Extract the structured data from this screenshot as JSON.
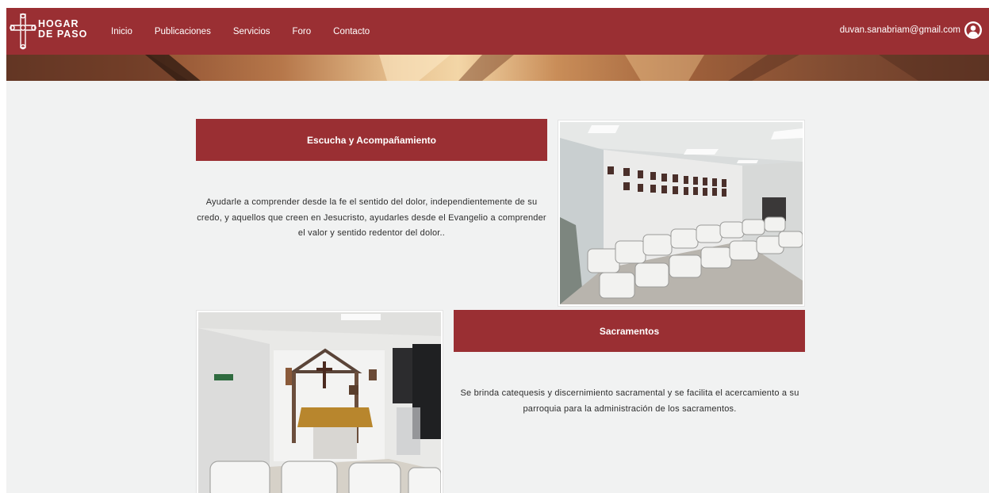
{
  "brand": {
    "line1": "HOGAR",
    "line2": "DE PASO",
    "icon": "cross-logo-icon"
  },
  "nav": {
    "items": [
      {
        "label": "Inicio"
      },
      {
        "label": "Publicaciones"
      },
      {
        "label": "Servicios"
      },
      {
        "label": "Foro"
      },
      {
        "label": "Contacto"
      }
    ]
  },
  "user": {
    "email": "duvan.sanabriam@gmail.com",
    "icon": "user-avatar-icon"
  },
  "sections": [
    {
      "title": "Escucha y Acompañamiento",
      "description": "Ayudarle a comprender desde la fe el sentido del dolor, independientemente de su credo, y aquellos que creen en Jesucristo, ayudarles desde el Evangelio a comprender el valor y sentido redentor del dolor..",
      "image": "chapel-room-chairs-photo"
    },
    {
      "title": "Sacramentos",
      "description": "Se brinda catequesis y discernimiento sacramental y se facilita el acercamiento a su parroquia para la administración de los sacramentos.",
      "image": "chapel-altar-photo"
    }
  ],
  "colors": {
    "brand": "#9a2f33",
    "background": "#f1f2f2",
    "text": "#2d2d2d"
  }
}
